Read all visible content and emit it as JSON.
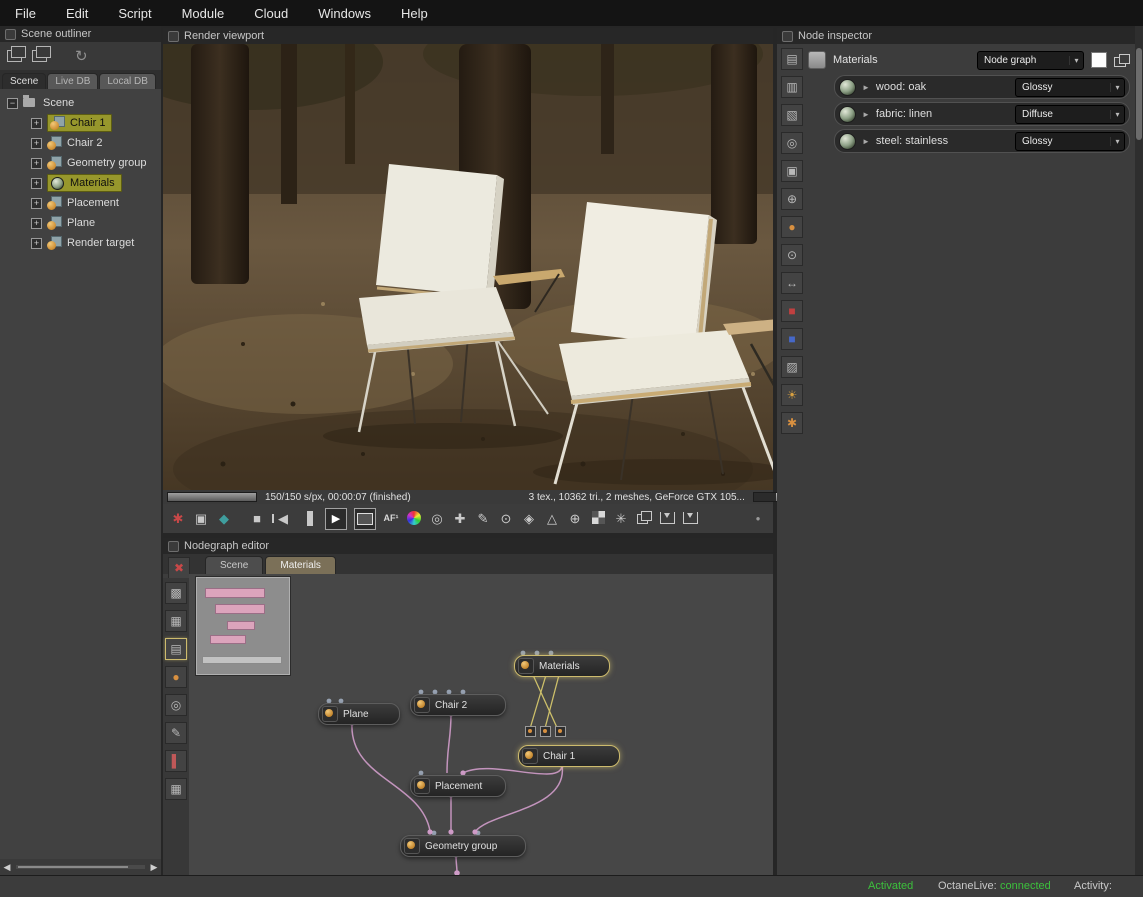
{
  "menu": {
    "items": [
      "File",
      "Edit",
      "Script",
      "Module",
      "Cloud",
      "Windows",
      "Help"
    ]
  },
  "outliner": {
    "title": "Scene outliner",
    "tabs": [
      {
        "label": "Scene"
      },
      {
        "label": "Live DB"
      },
      {
        "label": "Local DB"
      }
    ],
    "root_label": "Scene",
    "items": [
      {
        "label": "Chair 1",
        "selected": true
      },
      {
        "label": "Chair 2",
        "selected": false
      },
      {
        "label": "Geometry group",
        "selected": false
      },
      {
        "label": "Materials",
        "selected": true
      },
      {
        "label": "Placement",
        "selected": false
      },
      {
        "label": "Plane",
        "selected": false
      },
      {
        "label": "Render target",
        "selected": false
      }
    ]
  },
  "viewport": {
    "title": "Render viewport",
    "status_left": "150/150 s/px, 00:00:07 (finished)",
    "status_right": "3 tex., 10362 tri., 2 meshes, GeForce GTX 105...",
    "af_label": "AF¹"
  },
  "nodegraph": {
    "title": "Nodegraph editor",
    "tabs": [
      {
        "label": "Scene"
      },
      {
        "label": "Materials"
      }
    ],
    "nodes": [
      {
        "label": "Plane",
        "selected": false
      },
      {
        "label": "Chair 2",
        "selected": false
      },
      {
        "label": "Materials",
        "selected": true
      },
      {
        "label": "Chair 1",
        "selected": true
      },
      {
        "label": "Placement",
        "selected": false
      },
      {
        "label": "Geometry group",
        "selected": false
      }
    ]
  },
  "inspector": {
    "title": "Node inspector",
    "header": {
      "name": "Materials",
      "type": "Node graph"
    },
    "materials": [
      {
        "name": "wood: oak",
        "type": "Glossy"
      },
      {
        "name": "fabric: linen",
        "type": "Diffuse"
      },
      {
        "name": "steel: stainless",
        "type": "Glossy"
      }
    ]
  },
  "statusbar": {
    "activated": "Activated",
    "octane_label": "OctaneLive:",
    "octane_value": "connected",
    "activity_label": "Activity:"
  },
  "icons": {
    "refresh": "↻",
    "collapse": "−",
    "expand": "+",
    "expander": "►",
    "dd_arrow": "▾",
    "left": "◀",
    "right": "▶",
    "restart": "✱",
    "region": "▣",
    "subsample": "◆",
    "stop": "■",
    "rewind": "◀",
    "play": "▶",
    "alpha": "◎",
    "focus_pick": "✚",
    "wb_pick": "✎",
    "mat_pick": "⊙",
    "obj_pick": "◈",
    "cam_pick": "△",
    "zoom": "⊕",
    "denoise": "✳",
    "options": "●",
    "ng": [
      "✖",
      "▩",
      "▦",
      "▤",
      "●",
      "◎",
      "✎",
      "▌",
      "▦"
    ],
    "insp": [
      "▤",
      "▥",
      "▧",
      "◎",
      "▣",
      "⊕",
      "●",
      "⊙",
      "↔",
      "■",
      "■",
      "▨",
      "☀",
      "✱"
    ]
  },
  "colors": {
    "selection": "#97972c",
    "node_selected": "#cdbb6d",
    "edge_pink": "#c394bd",
    "edge_yellow": "#cdc06a",
    "status_green": "#3cc13c"
  }
}
